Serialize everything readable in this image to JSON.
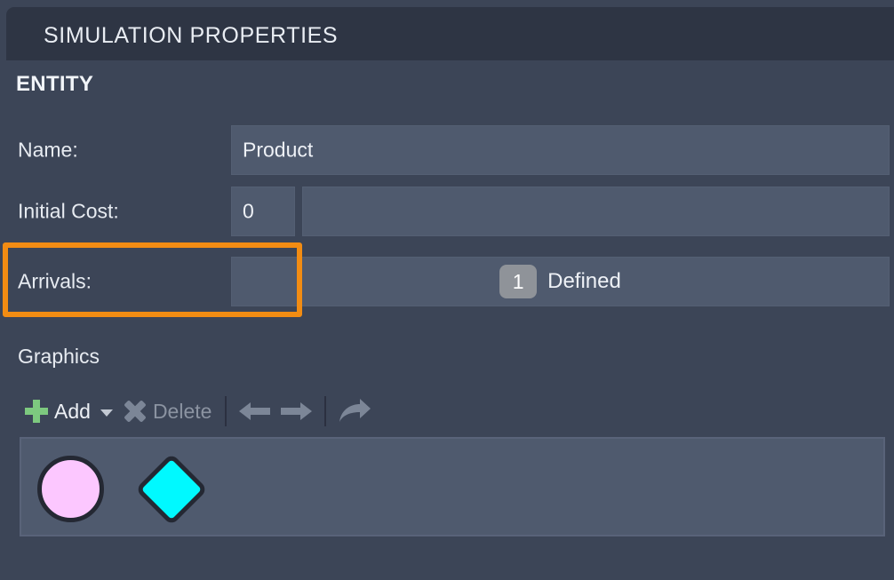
{
  "header": {
    "tab_title": "SIMULATION PROPERTIES"
  },
  "section": {
    "title": "ENTITY"
  },
  "properties": [
    {
      "label": "Name:",
      "value": "Product"
    },
    {
      "label": "Initial Cost:",
      "value": "0"
    }
  ],
  "arrivals": {
    "label": "Arrivals:",
    "count": "1",
    "status": "Defined"
  },
  "graphics": {
    "title": "Graphics",
    "toolbar": {
      "add_label": "Add",
      "add_icon": "plus-icon",
      "add_dropdown_icon": "chevron-down-icon",
      "delete_label": "Delete",
      "delete_icon": "close-x-icon",
      "delete_enabled": false,
      "back_icon": "arrow-left-icon",
      "forward_icon": "arrow-right-icon",
      "share_icon": "curved-forward-arrow-icon"
    },
    "shapes": [
      {
        "name": "circle-shape",
        "fill": "#fcc7ff",
        "stroke": "#242833"
      },
      {
        "name": "diamond-shape",
        "fill": "#00f9ff",
        "stroke": "#242833"
      }
    ]
  },
  "highlight": {
    "name": "initial-cost-highlight",
    "color": "#f28c13"
  },
  "colors": {
    "background": "#3c4557",
    "header_tab": "#2e3544",
    "field": "#4f5a6e",
    "text": "#eef1f6",
    "disabled_text": "#8b93a1",
    "accent_orange": "#f28c13",
    "badge": "#8f9399",
    "plus_green": "#7dc97f"
  }
}
